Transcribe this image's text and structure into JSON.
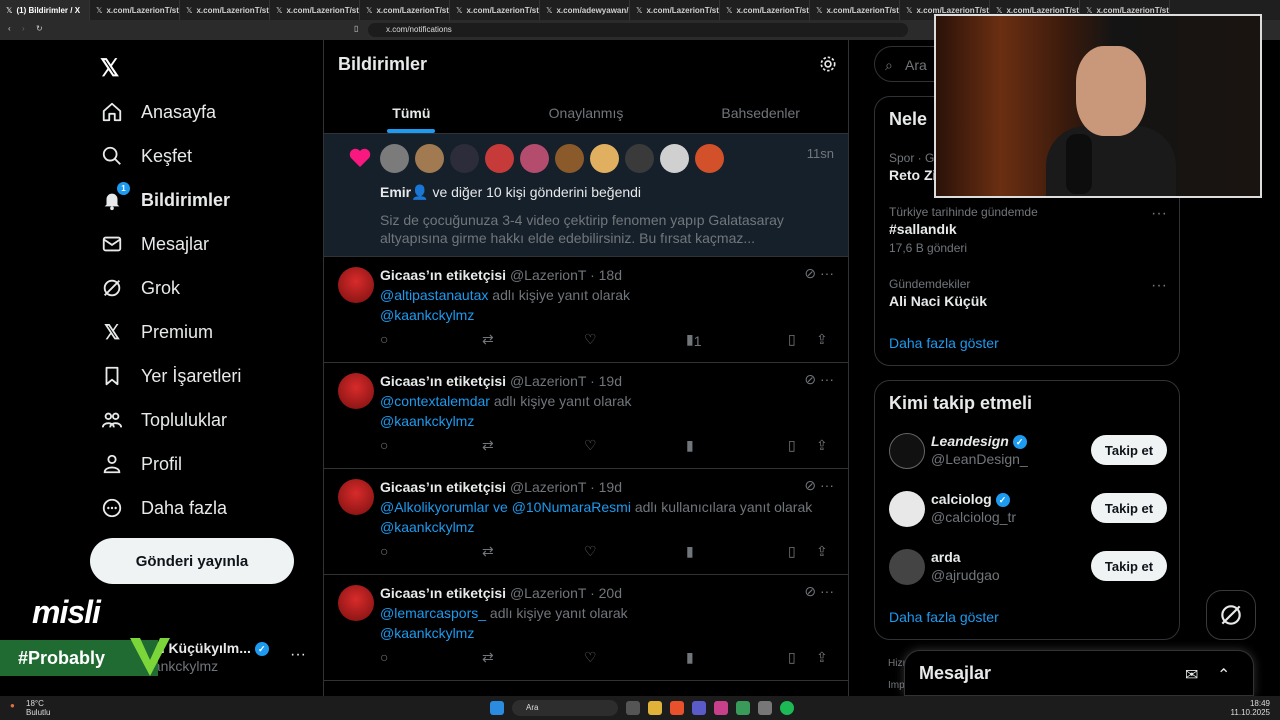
{
  "browser": {
    "tabs": [
      {
        "label": "(1) Bildirimler / X",
        "active": true
      },
      {
        "label": "x.com/LazerionT/status/"
      },
      {
        "label": "x.com/LazerionT/status/"
      },
      {
        "label": "x.com/LazerionT/status/"
      },
      {
        "label": "x.com/LazerionT/status/"
      },
      {
        "label": "x.com/LazerionT/status/"
      },
      {
        "label": "x.com/adewyawan/statu"
      },
      {
        "label": "x.com/LazerionT/status/"
      },
      {
        "label": "x.com/LazerionT/status/"
      },
      {
        "label": "x.com/LazerionT/status/"
      },
      {
        "label": "x.com/LazerionT/status/"
      },
      {
        "label": "x.com/LazerionT/status/"
      },
      {
        "label": "x.com/LazerionT/status/"
      }
    ],
    "url": "x.com/notifications"
  },
  "nav": {
    "items": [
      {
        "label": "Anasayfa",
        "icon": "home-icon"
      },
      {
        "label": "Keşfet",
        "icon": "search-icon"
      },
      {
        "label": "Bildirimler",
        "icon": "bell-icon",
        "badge": "1"
      },
      {
        "label": "Mesajlar",
        "icon": "mail-icon"
      },
      {
        "label": "Grok",
        "icon": "grok-icon"
      },
      {
        "label": "Premium",
        "icon": "x-icon"
      },
      {
        "label": "Yer İşaretleri",
        "icon": "bookmark-icon"
      },
      {
        "label": "Topluluklar",
        "icon": "communities-icon"
      },
      {
        "label": "Profil",
        "icon": "person-icon"
      },
      {
        "label": "Daha fazla",
        "icon": "more-circle-icon"
      }
    ],
    "post_label": "Gönderi yayınla",
    "profile_name": "n Küçükyılm...",
    "profile_handle": "kaankckylmz"
  },
  "overlay": {
    "misli": "misli",
    "probably": "#Probably"
  },
  "main": {
    "title": "Bildirimler",
    "tabs": [
      "Tümü",
      "Onaylanmış",
      "Bahsedenler"
    ],
    "like_notification": {
      "time": "11sn",
      "bold": "Emir",
      "rest": " ve diğer 10 kişi gönderini beğendi",
      "text": "Siz de çocuğunuza 3-4 video çektirip fenomen yapıp Galatasaray altyapısına girme hakkı elde edebilirsiniz. Bu fırsat kaçmaz..."
    },
    "replies": [
      {
        "name": "Gicaas’ın etiketçisi",
        "handle": "@LazerionT",
        "time": "· 18d",
        "mention": "@altipastanautax",
        "suffix": " adlı kişiye yanıt olarak",
        "target": "@kaankckylmz",
        "views": "1"
      },
      {
        "name": "Gicaas’ın etiketçisi",
        "handle": "@LazerionT",
        "time": "· 19d",
        "mention": "@contextalemdar",
        "suffix": " adlı kişiye yanıt olarak",
        "target": "@kaankckylmz",
        "views": ""
      },
      {
        "name": "Gicaas’ın etiketçisi",
        "handle": "@LazerionT",
        "time": "· 19d",
        "mention": "@Alkolikyorumlar ve @10NumaraResmi",
        "suffix": " adlı kullanıcılara yanıt olarak",
        "target": "@kaankckylmz",
        "views": ""
      },
      {
        "name": "Gicaas’ın etiketçisi",
        "handle": "@LazerionT",
        "time": "· 20d",
        "mention": "@lemarcaspors_",
        "suffix": " adlı kişiye yanıt olarak",
        "target": "@kaankckylmz",
        "views": ""
      }
    ]
  },
  "right": {
    "search_placeholder": "Ara",
    "trends_title": "Nele",
    "trends": [
      {
        "caption": "Spor · G",
        "title": "Reto Zi",
        "count": ""
      },
      {
        "caption": "Türkiye tarihinde gündemde",
        "title": "#sallandık",
        "count": "17,6 B gönderi"
      },
      {
        "caption": "Gündemdekiler",
        "title": "Ali Naci Küçük",
        "count": ""
      }
    ],
    "show_more": "Daha fazla göster",
    "who_title": "Kimi takip etmeli",
    "who": [
      {
        "name": "Leandesign",
        "handle": "@LeanDesign_",
        "follow": "Takip et"
      },
      {
        "name": "calciolog",
        "handle": "@calciolog_tr",
        "follow": "Takip et"
      },
      {
        "name": "arda",
        "handle": "@ajrudgao",
        "follow": "Takip et"
      }
    ],
    "show_more2": "Daha fazla göster",
    "footer1": "Hizı",
    "footer2": "Imp"
  },
  "messages_bar": {
    "title": "Mesajlar"
  },
  "taskbar": {
    "search": "Ara",
    "temp": "18°C",
    "weather": "Bulutlu",
    "time": "18:49",
    "date": "11.10.2025"
  }
}
